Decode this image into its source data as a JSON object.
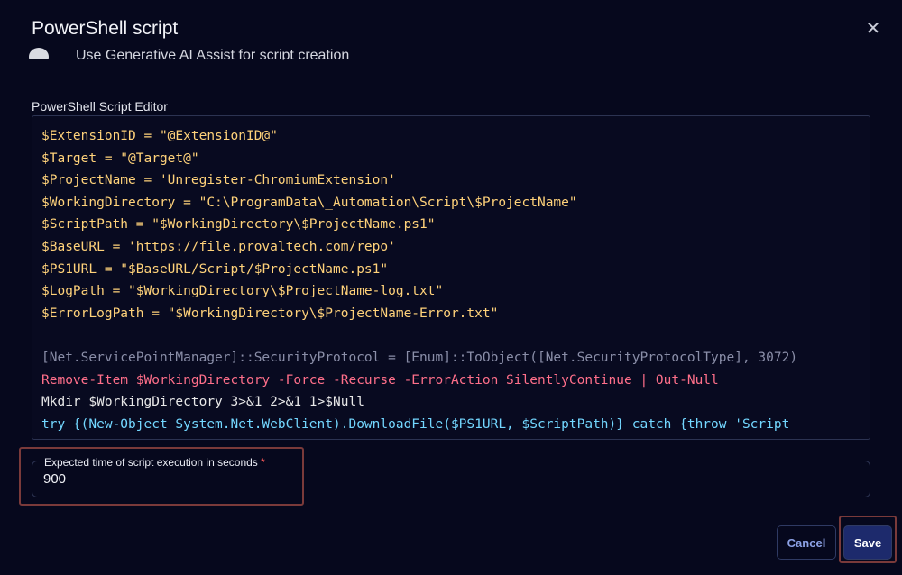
{
  "dialog": {
    "title": "PowerShell script",
    "close_icon": "close-icon"
  },
  "ai_assist": {
    "label": "Use Generative AI Assist for script creation"
  },
  "editor": {
    "label": "PowerShell Script Editor",
    "lines": [
      "$ExtensionID = \"@ExtensionID@\"",
      "$Target = \"@Target@\"",
      "$ProjectName = 'Unregister-ChromiumExtension'",
      "$WorkingDirectory = \"C:\\ProgramData\\_Automation\\Script\\$ProjectName\"",
      "$ScriptPath = \"$WorkingDirectory\\$ProjectName.ps1\"",
      "$BaseURL = 'https://file.provaltech.com/repo'",
      "$PS1URL = \"$BaseURL/Script/$ProjectName.ps1\"",
      "$LogPath = \"$WorkingDirectory\\$ProjectName-log.txt\"",
      "$ErrorLogPath = \"$WorkingDirectory\\$ProjectName-Error.txt\"",
      "",
      "[Net.ServicePointManager]::SecurityProtocol = [Enum]::ToObject([Net.SecurityProtocolType], 3072)",
      "Remove-Item $WorkingDirectory -Force -Recurse -ErrorAction SilentlyContinue | Out-Null",
      "Mkdir $WorkingDirectory 3>&1 2>&1 1>$Null",
      "try {(New-Object System.Net.WebClient).DownloadFile($PS1URL, $ScriptPath)} catch {throw 'Script"
    ]
  },
  "execution_time": {
    "label": "Expected time of script execution in seconds",
    "required_mark": "*",
    "value": "900"
  },
  "buttons": {
    "cancel": "Cancel",
    "save": "Save"
  },
  "colors": {
    "background": "#06081d",
    "accent": "#1d2a6c",
    "required": "#ff5a5a"
  }
}
